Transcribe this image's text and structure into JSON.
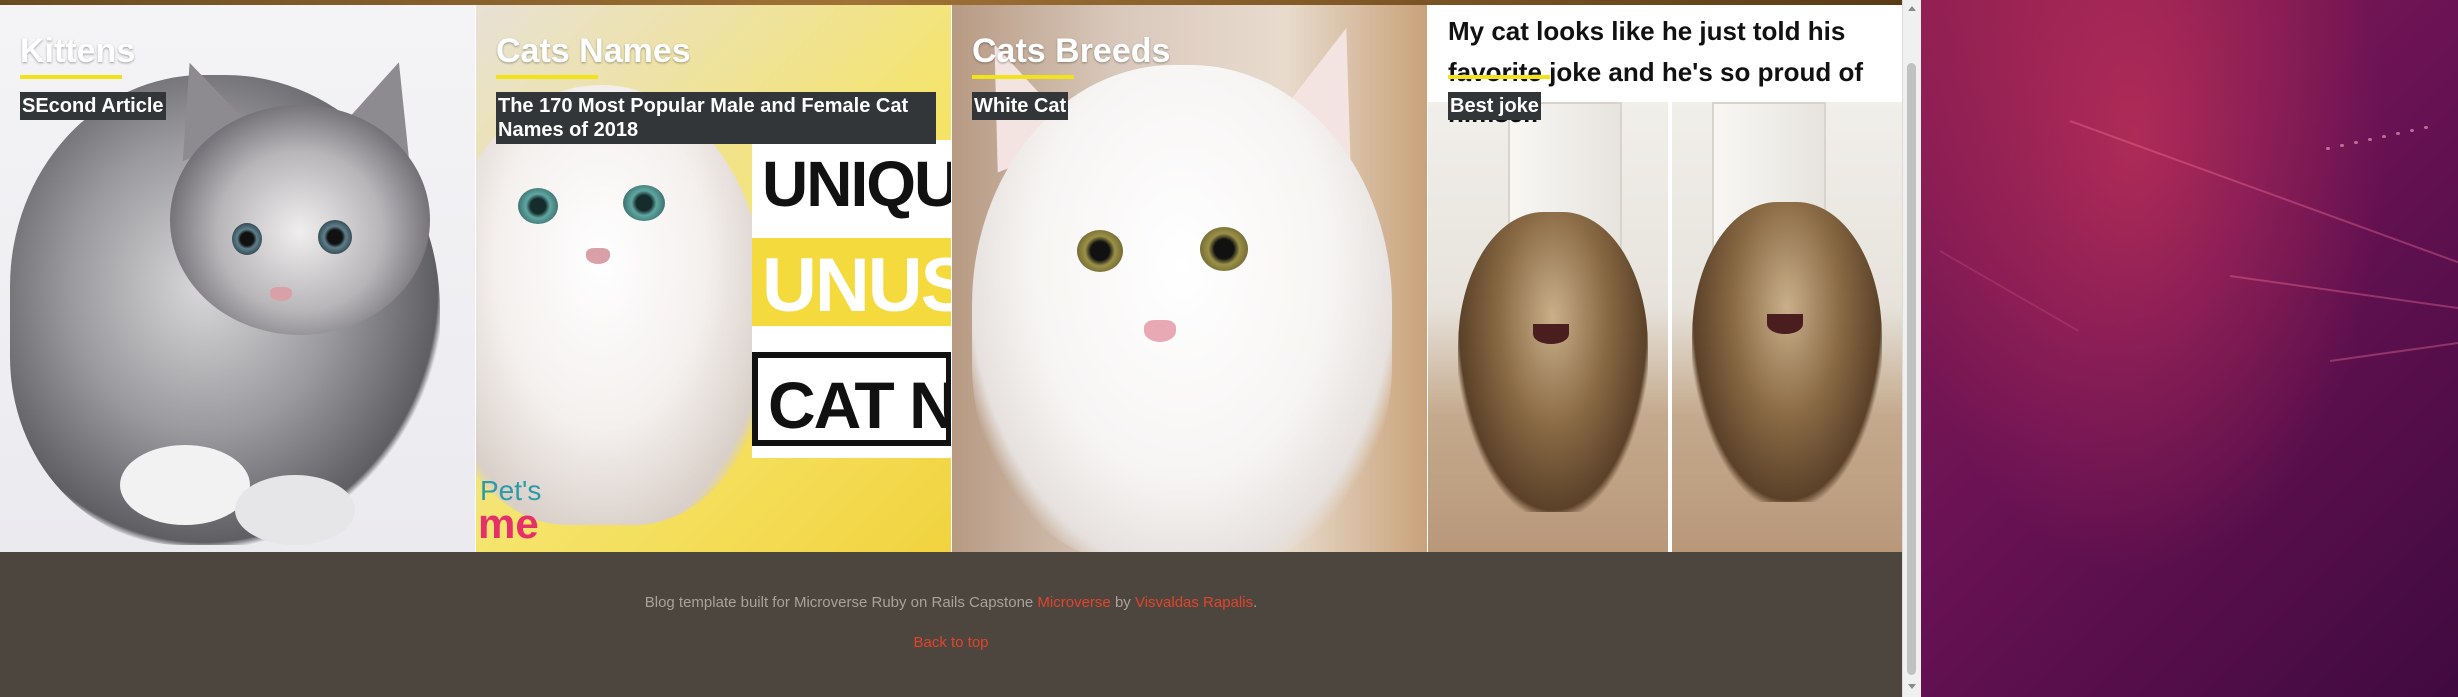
{
  "articles": [
    {
      "title": "Kittens",
      "subtitle": "SEcond Article"
    },
    {
      "title": "Cats Names",
      "subtitle": "The 170 Most Popular Male and Female Cat Names of 2018"
    },
    {
      "title": "Cats Breeds",
      "subtitle": "White Cat"
    },
    {
      "title": "My cat looks like he just told his favorite joke and he's so proud of himself",
      "subtitle": "Best joke"
    }
  ],
  "poster": {
    "line1": "UNIQUE",
    "line2": "UNUSUAL",
    "line3": "CAT NAMES",
    "brand_top": "Pet's",
    "brand_bottom": "me"
  },
  "footer": {
    "text": "Blog template built for Microverse Ruby on Rails Capstone",
    "link_microverse": "Microverse",
    "by": "by",
    "link_author": "Visvaldas Rapalis",
    "period": ".",
    "back_to_top": "Back to top"
  },
  "colors": {
    "accent_underline": "#f2e318",
    "link": "#e0442b",
    "footer_bg": "#4d463f"
  }
}
